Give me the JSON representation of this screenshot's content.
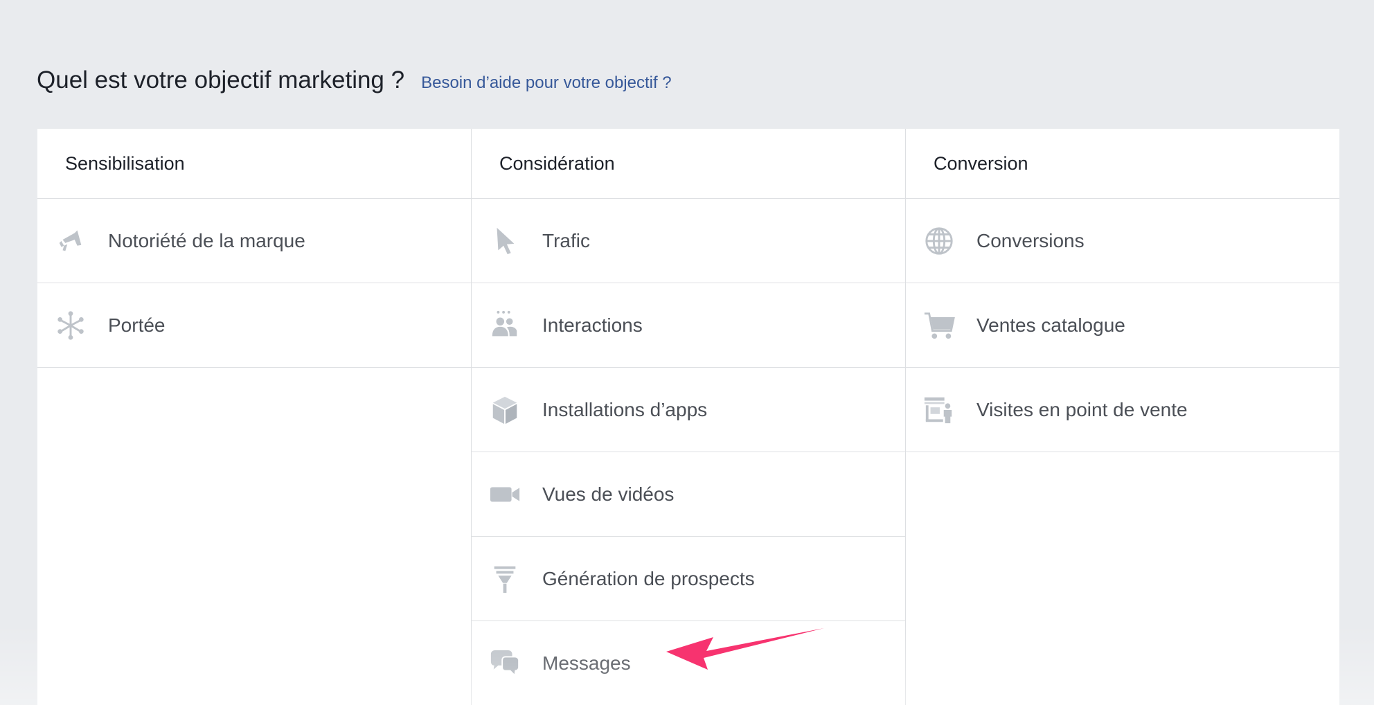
{
  "header": {
    "title": "Quel est votre objectif marketing ?",
    "help_link": "Besoin d’aide pour votre objectif ?"
  },
  "columns": [
    {
      "title": "Sensibilisation",
      "items": [
        {
          "label": "Notoriété de la marque",
          "icon": "megaphone-icon"
        },
        {
          "label": "Portée",
          "icon": "reach-asterisk-icon"
        }
      ]
    },
    {
      "title": "Considération",
      "items": [
        {
          "label": "Trafic",
          "icon": "cursor-pointer-icon"
        },
        {
          "label": "Interactions",
          "icon": "people-engagement-icon"
        },
        {
          "label": "Installations d’apps",
          "icon": "cube-box-icon"
        },
        {
          "label": "Vues de vidéos",
          "icon": "video-camera-icon"
        },
        {
          "label": "Génération de prospects",
          "icon": "funnel-icon"
        },
        {
          "label": "Messages",
          "icon": "chat-bubbles-icon"
        }
      ]
    },
    {
      "title": "Conversion",
      "items": [
        {
          "label": "Conversions",
          "icon": "globe-icon"
        },
        {
          "label": "Ventes catalogue",
          "icon": "shopping-cart-icon"
        },
        {
          "label": "Visites en point de vente",
          "icon": "store-visit-icon"
        }
      ]
    }
  ],
  "colors": {
    "background": "#e9ebee",
    "panel": "#ffffff",
    "divider": "#dddfe2",
    "icon": "#bec3c9",
    "link": "#365899",
    "annotation_arrow": "#f7336f"
  }
}
